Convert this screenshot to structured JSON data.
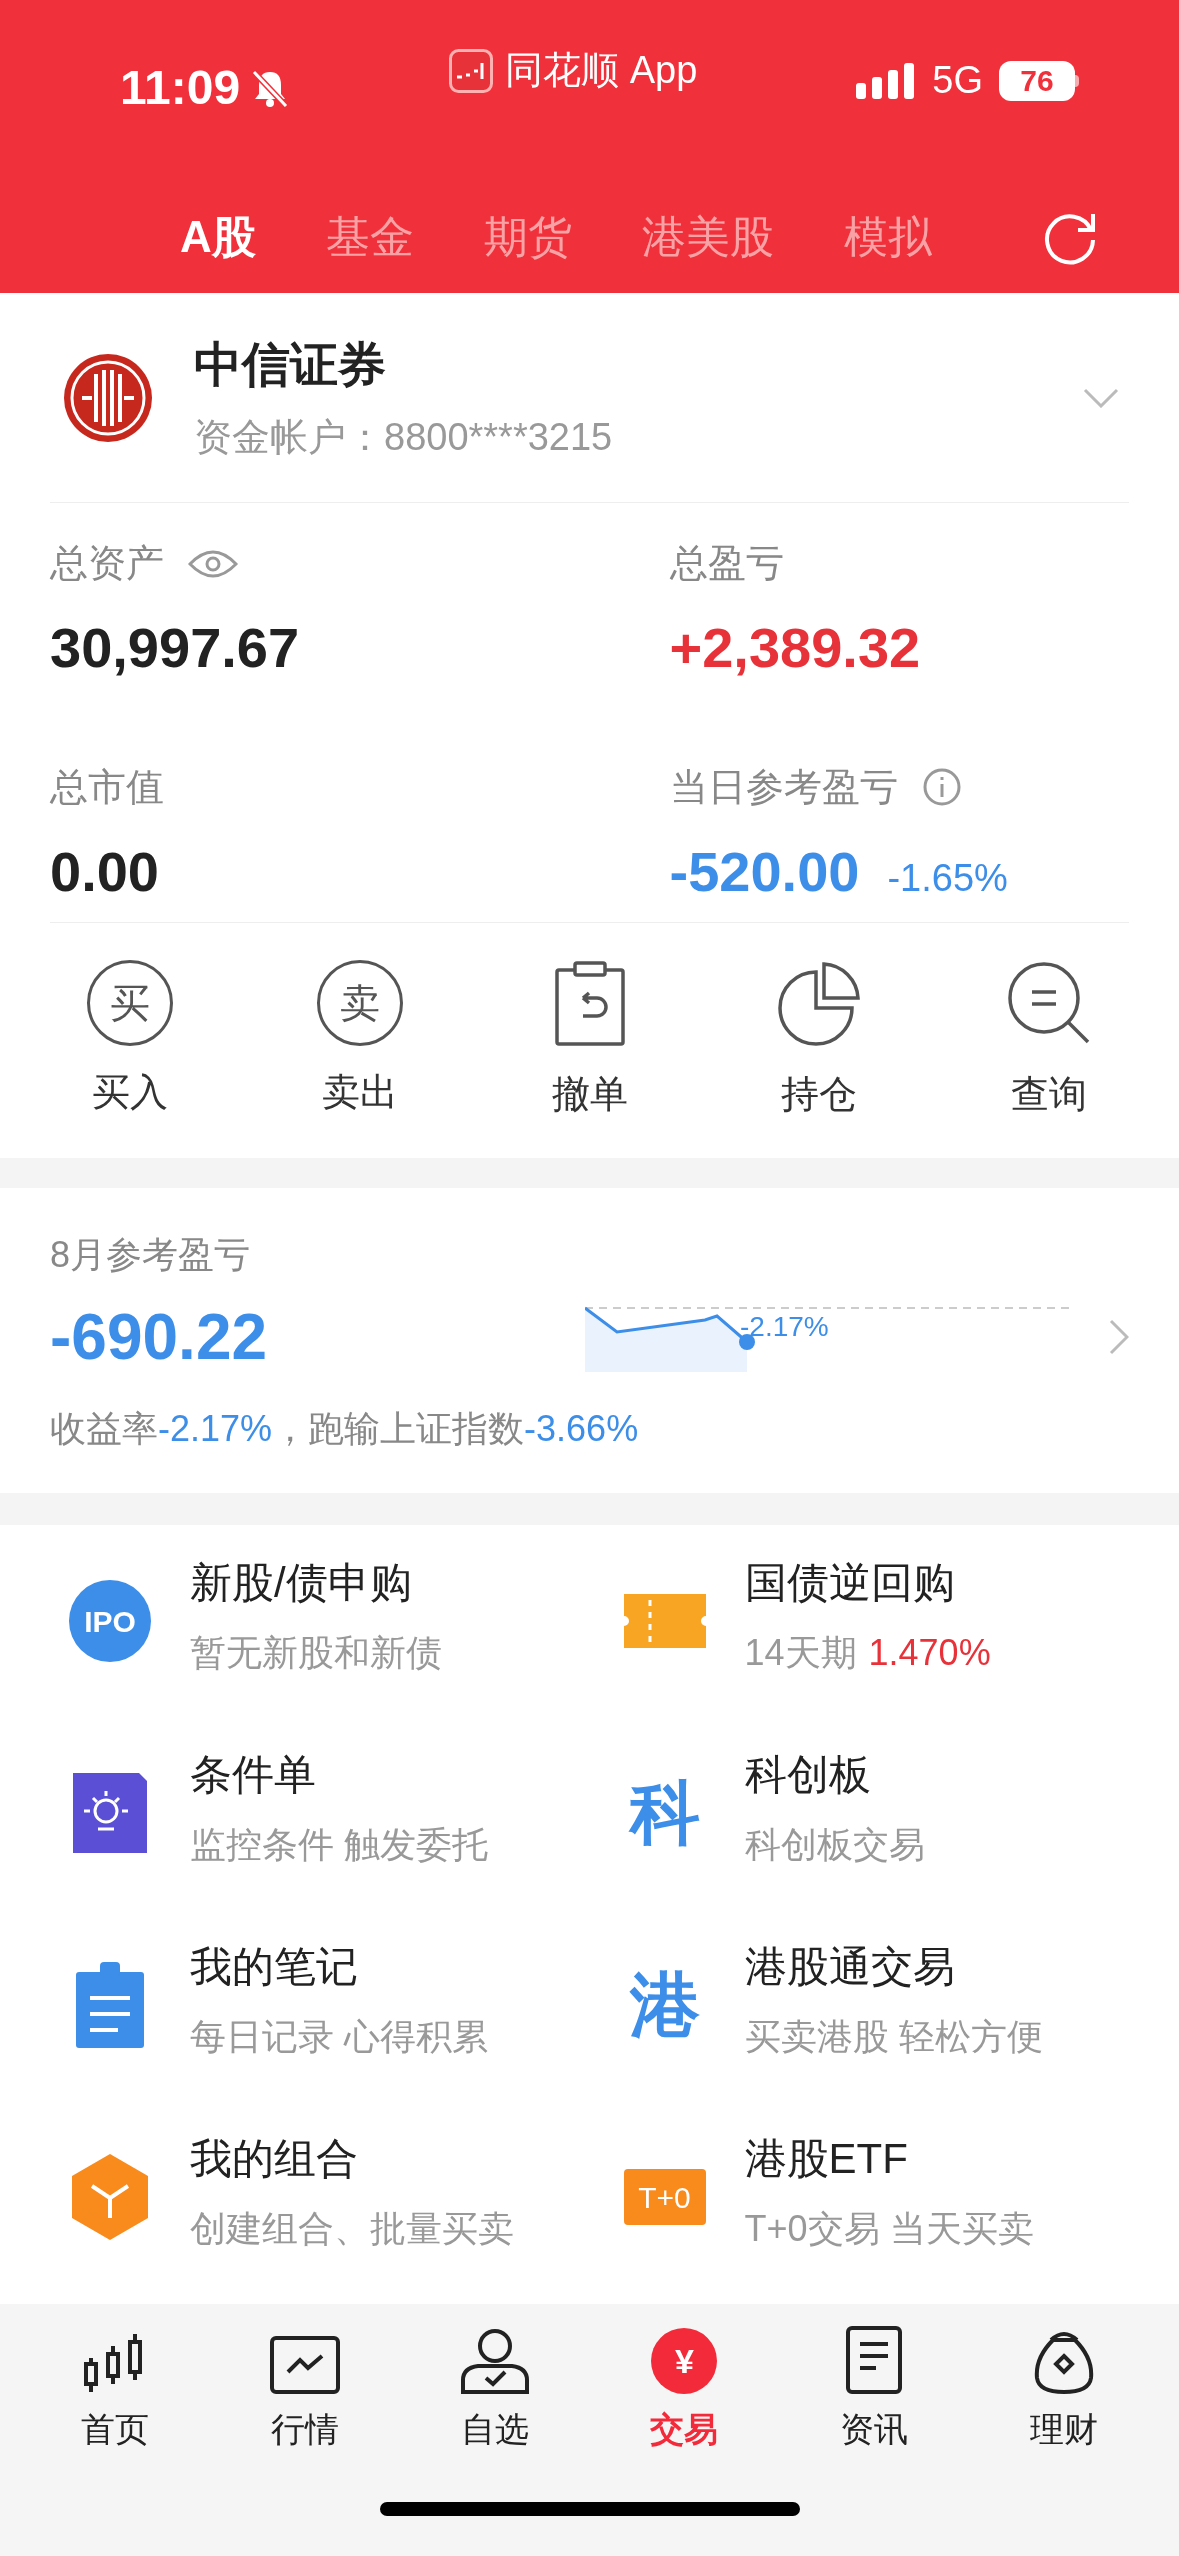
{
  "status_bar": {
    "time": "11:09",
    "app": "同花顺 App",
    "network": "5G",
    "battery": "76"
  },
  "tabs": [
    {
      "label": "A股",
      "selected": true
    },
    {
      "label": "基金",
      "selected": false
    },
    {
      "label": "期货",
      "selected": false
    },
    {
      "label": "港美股",
      "selected": false
    },
    {
      "label": "模拟",
      "selected": false
    }
  ],
  "broker": {
    "name": "中信证券",
    "account": "资金帐户：8800****3215"
  },
  "stats": [
    {
      "label": "总资产",
      "value": "30,997.67",
      "kind": "total"
    },
    {
      "label": "总盈亏",
      "value": "+2,389.32",
      "kind": "gain"
    },
    {
      "label": "总市值",
      "value": "0.00",
      "kind": "plain"
    },
    {
      "label": "当日参考盈亏",
      "value": "-520.00",
      "kind": "loss",
      "percent": "-1.65%"
    }
  ],
  "actions": [
    {
      "label": "买入",
      "kind": "buy",
      "glyph": "买"
    },
    {
      "label": "卖出",
      "kind": "sell",
      "glyph": "卖"
    },
    {
      "label": "撤单",
      "kind": "cancel"
    },
    {
      "label": "持仓",
      "kind": "pie"
    },
    {
      "label": "查询",
      "kind": "search"
    }
  ],
  "monthly": {
    "title": "8月参考盈亏",
    "value": "-690.22",
    "chart_label": "-2.17%",
    "summary": "收益率**-2.17%**，跑输上证指数**-3.66%**"
  },
  "services": [
    {
      "title": "新股/债申购",
      "subtitle": "暂无新股和新债",
      "kind": "ipo",
      "icon_text": "IPO"
    },
    {
      "title": "国债逆回购",
      "subtitle": "14天期",
      "highlight": "1.470%",
      "kind": "ticket"
    },
    {
      "title": "条件单",
      "subtitle": "监控条件 触发委托",
      "kind": "sun"
    },
    {
      "title": "科创板",
      "subtitle": "科创板交易",
      "kind": "char",
      "icon_text": "科"
    },
    {
      "title": "我的笔记",
      "subtitle": "每日记录 心得积累",
      "kind": "note"
    },
    {
      "title": "港股通交易",
      "subtitle": "买卖港股 轻松方便",
      "kind": "char",
      "icon_text": "港"
    },
    {
      "title": "我的组合",
      "subtitle": "创建组合、批量买卖",
      "kind": "cube"
    },
    {
      "title": "港股ETF",
      "subtitle": "T+0交易 当天买卖",
      "kind": "tag",
      "icon_text": "T+0"
    }
  ],
  "nav": [
    {
      "label": "首页",
      "kind": "candles",
      "selected": false
    },
    {
      "label": "行情",
      "kind": "chart",
      "selected": false
    },
    {
      "label": "自选",
      "kind": "person",
      "selected": false
    },
    {
      "label": "交易",
      "kind": "yen",
      "badge": "¥",
      "selected": true
    },
    {
      "label": "资讯",
      "kind": "doc",
      "selected": false
    },
    {
      "label": "理财",
      "kind": "bag",
      "selected": false
    }
  ]
}
